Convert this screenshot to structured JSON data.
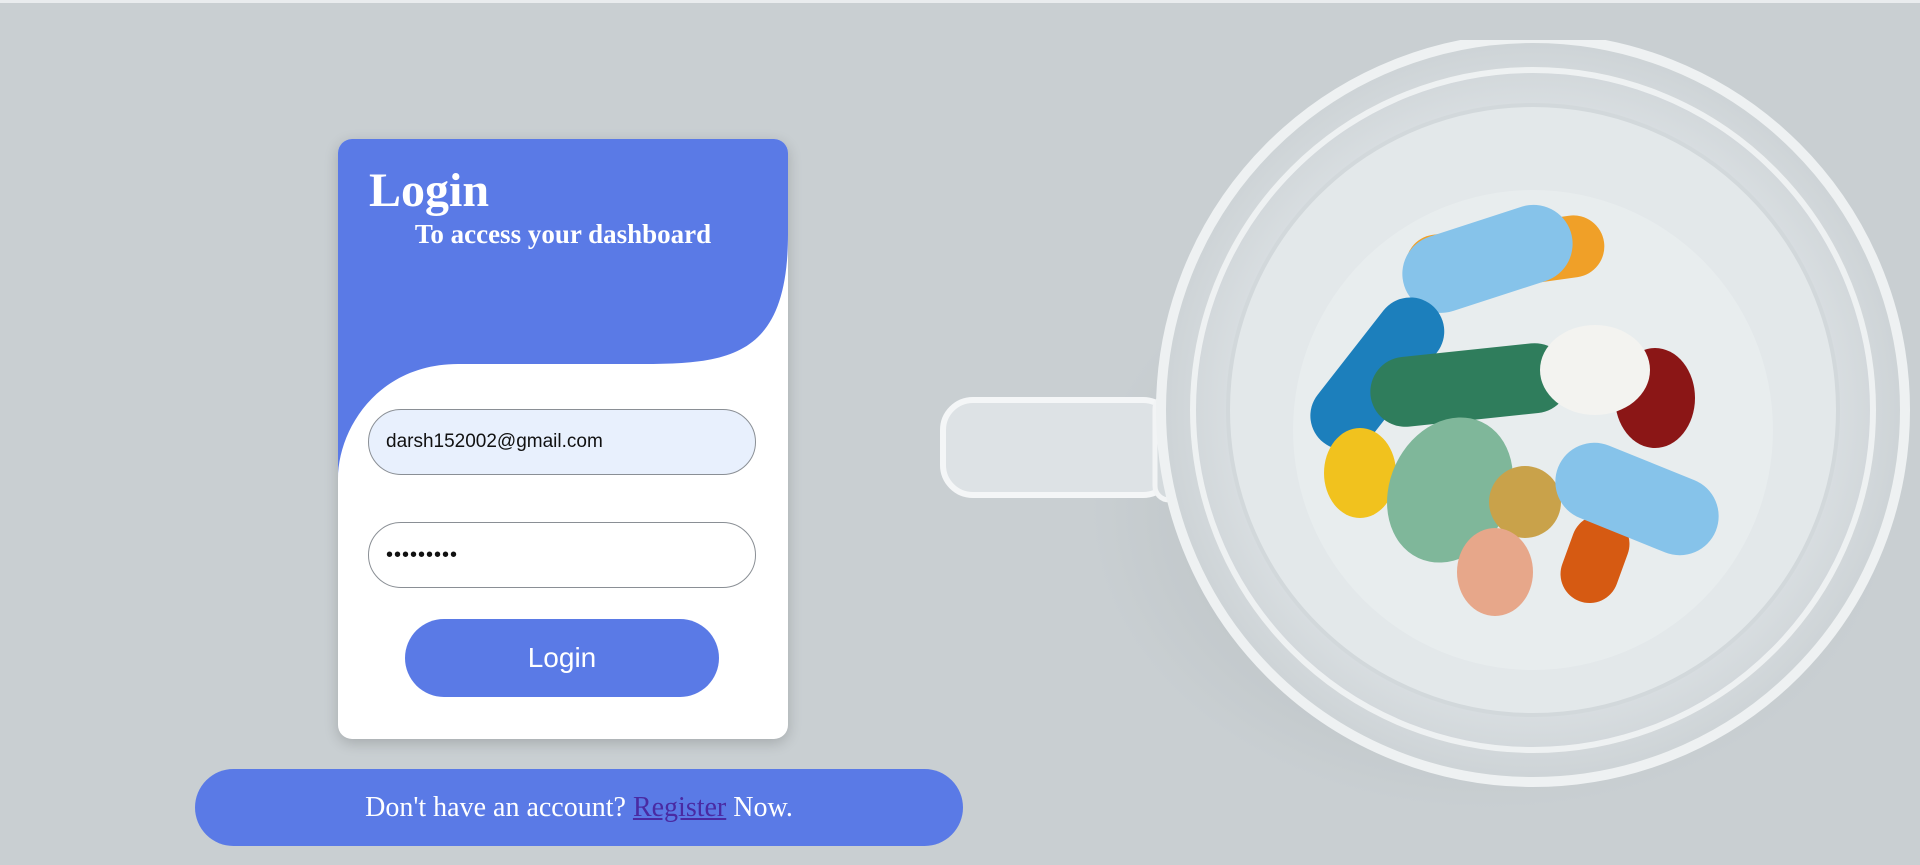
{
  "login_card": {
    "title": "Login",
    "subtitle": "To access your dashboard",
    "email": {
      "value": "darsh152002@gmail.com"
    },
    "password": {
      "value": "•••••••••"
    },
    "login_button": "Login"
  },
  "register": {
    "prefix": "Don't have an account?",
    "link_label": "Register",
    "suffix": "Now."
  },
  "colors": {
    "background": "#c9cfd2",
    "accent": "#5a7ae6",
    "link": "#4a2aa2"
  },
  "images": {
    "hero": "glass-cup-of-pills-photo"
  }
}
